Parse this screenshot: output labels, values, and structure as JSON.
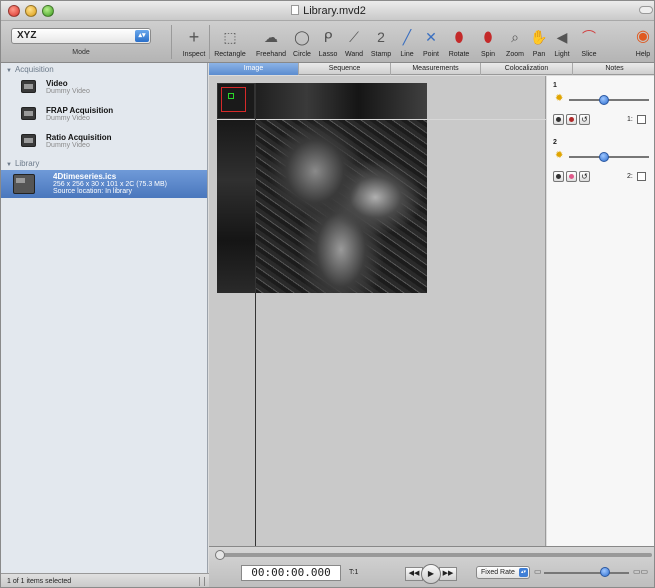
{
  "window": {
    "title": "Library.mvd2"
  },
  "toolbar": {
    "mode_value": "XYZ",
    "mode_label": "Mode",
    "tools": [
      {
        "label": "Inspect",
        "icon": "crosshair-icon",
        "glyph": "+"
      },
      {
        "label": "Rectangle",
        "icon": "rectangle-icon",
        "glyph": "⬚"
      },
      {
        "label": "Freehand",
        "icon": "freehand-icon",
        "glyph": "☁"
      },
      {
        "label": "Circle",
        "icon": "circle-icon",
        "glyph": "◯"
      },
      {
        "label": "Lasso",
        "icon": "lasso-icon",
        "glyph": "ᑭ"
      },
      {
        "label": "Wand",
        "icon": "wand-icon",
        "glyph": "⟋"
      },
      {
        "label": "Stamp",
        "icon": "stamp-icon",
        "glyph": "2"
      },
      {
        "label": "Line",
        "icon": "line-icon",
        "glyph": "╱"
      },
      {
        "label": "Point",
        "icon": "point-icon",
        "glyph": "✕"
      },
      {
        "label": "Rotate",
        "icon": "rotate-icon",
        "glyph": "⬮"
      },
      {
        "label": "Spin",
        "icon": "spin-icon",
        "glyph": "⬮"
      },
      {
        "label": "Zoom",
        "icon": "zoom-icon",
        "glyph": "⌕"
      },
      {
        "label": "Pan",
        "icon": "hand-icon",
        "glyph": "✋"
      },
      {
        "label": "Light",
        "icon": "light-icon",
        "glyph": "◀"
      },
      {
        "label": "Slice",
        "icon": "slice-icon",
        "glyph": "⌒"
      },
      {
        "label": "Help",
        "icon": "help-icon",
        "glyph": "◉"
      }
    ]
  },
  "sidebar": {
    "acquisition": {
      "header": "Acquisition",
      "items": [
        {
          "name": "Video",
          "sub": "Dummy Video"
        },
        {
          "name": "FRAP Acquisition",
          "sub": "Dummy Video"
        },
        {
          "name": "Ratio Acquisition",
          "sub": "Dummy Video"
        }
      ]
    },
    "library": {
      "header": "Library",
      "selected": {
        "name": "4Dtimeseries.ics",
        "details": "256 x 256 x 30 x 101 x 2C (75.3 MB)",
        "location": "Source location: In library"
      }
    }
  },
  "tabs": [
    "Image",
    "Sequence",
    "Measurements",
    "Colocalization",
    "Notes"
  ],
  "channels": [
    {
      "label": "1",
      "checkbox_label": "1:"
    },
    {
      "label": "2",
      "checkbox_label": "2:"
    }
  ],
  "timeline": {
    "timecode": "00:00:00.000",
    "frame": "T:1",
    "rate": "Fixed Rate"
  },
  "status": {
    "text": "1 of 1 items selected"
  },
  "colors": {
    "selection": "#4a77bd",
    "tab_active": "#5b8ccf",
    "slider_knob": "#2e6fd0"
  }
}
